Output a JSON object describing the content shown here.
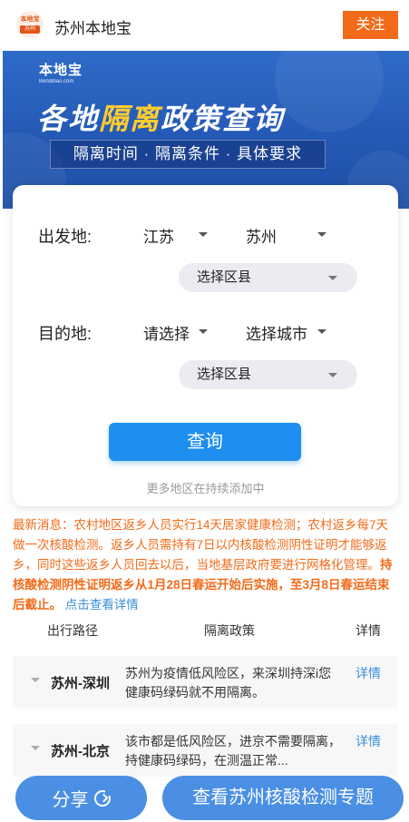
{
  "header": {
    "logo_top_text": "本地宝",
    "logo_city_text": "苏州",
    "title": "苏州本地宝",
    "follow_label": "关注"
  },
  "banner": {
    "brand": "本地宝",
    "brand_domain": "Bendibao.com",
    "title_part1": "各地",
    "title_highlight": "隔离",
    "title_part2": "政策查询",
    "subtitle": "隔离时间 · 隔离条件 · 具体要求"
  },
  "form": {
    "departure_label": "出发地:",
    "departure_province": "江苏",
    "departure_city": "苏州",
    "departure_district_placeholder": "选择区县",
    "destination_label": "目的地:",
    "destination_province": "请选择",
    "destination_city": "选择城市",
    "destination_district_placeholder": "选择区县",
    "query_label": "查询",
    "more_note": "更多地区在持续添加中"
  },
  "notice": {
    "text": "最新消息：农村地区返乡人员实行14天居家健康检测；农村返乡每7天做一次核酸检测。返乡人员需持有7日以内核酸检测阴性证明才能够返乡，同时这些返乡人员回去以后，当地基层政府要进行网格化管理。",
    "bold_text": "持核酸检测阴性证明返乡从1月28日春运开始后实施，至3月8日春运结束后截止。",
    "link_text": "点击查看详情"
  },
  "table": {
    "headers": [
      "出行路径",
      "隔离政策",
      "详情"
    ],
    "rows": [
      {
        "route": "苏州-深圳",
        "policy": "苏州为疫情低风险区，来深圳持深i您健康码绿码就不用隔离。",
        "detail": "详情"
      },
      {
        "route": "苏州-北京",
        "policy": "该市都是低风险区，进京不需要隔离，持健康码绿码，在测温正常...",
        "detail": "详情"
      }
    ]
  },
  "bottom": {
    "share_label": "分享",
    "topic_label": "查看苏州核酸检测专题"
  },
  "colors": {
    "accent_orange": "#f26b1a",
    "primary_blue": "#1e8ef0",
    "bottom_blue": "#4a8fe3",
    "link_blue": "#3a8fd9"
  }
}
